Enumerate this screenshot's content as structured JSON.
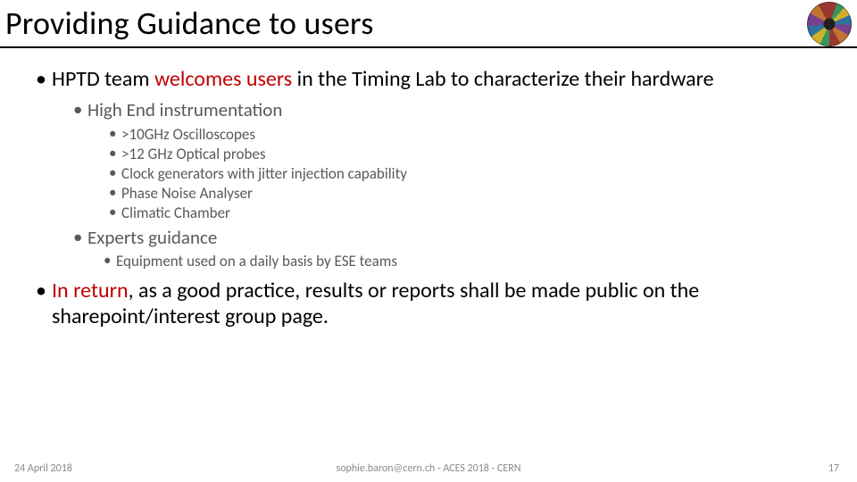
{
  "title": "Providing Guidance to users",
  "bullets": {
    "main1_pre": "HPTD team ",
    "main1_accent": "welcomes users",
    "main1_post": " in the Timing Lab to characterize their hardware",
    "sub1": "High End instrumentation",
    "items": [
      ">10GHz Oscilloscopes",
      ">12 GHz Optical probes",
      "Clock generators with jitter injection capability",
      "Phase Noise Analyser",
      "Climatic Chamber"
    ],
    "sub2": "Experts guidance",
    "sub2_item": "Equipment used on a daily basis by ESE teams",
    "main2_accent": "In return",
    "main2_post": ", as a good practice, results or reports shall be made public on the sharepoint/interest group page."
  },
  "footer": {
    "date": "24 April 2018",
    "center": "sophie.baron@cern.ch - ACES 2018 - CERN",
    "page": "17"
  }
}
